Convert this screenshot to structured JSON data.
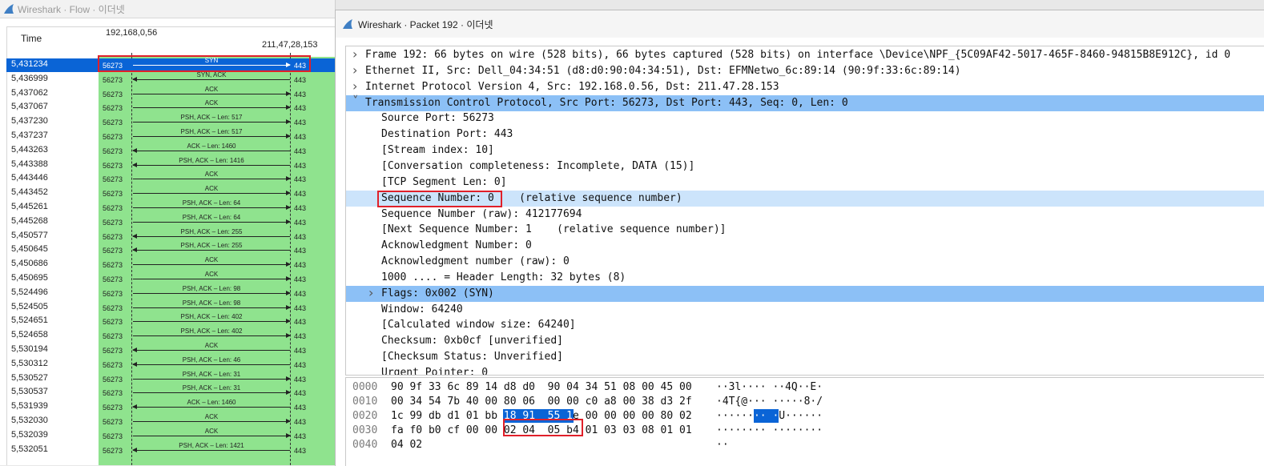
{
  "flow_window": {
    "title": "Wireshark · Flow · 이더넷",
    "header_time": "Time",
    "src_host": "192,168,0,56",
    "dst_host": "211,47,28,153",
    "rows": [
      {
        "time": "5,431234",
        "src_port": "56273",
        "label": "SYN",
        "dst_port": "443",
        "dir": "right",
        "selected": true
      },
      {
        "time": "5,436999",
        "src_port": "56273",
        "label": "SYN, ACK",
        "dst_port": "443",
        "dir": "left"
      },
      {
        "time": "5,437062",
        "src_port": "56273",
        "label": "ACK",
        "dst_port": "443",
        "dir": "right"
      },
      {
        "time": "5,437067",
        "src_port": "56273",
        "label": "ACK",
        "dst_port": "443",
        "dir": "right"
      },
      {
        "time": "5,437230",
        "src_port": "56273",
        "label": "PSH, ACK – Len: 517",
        "dst_port": "443",
        "dir": "right"
      },
      {
        "time": "5,437237",
        "src_port": "56273",
        "label": "PSH, ACK – Len: 517",
        "dst_port": "443",
        "dir": "right"
      },
      {
        "time": "5,443263",
        "src_port": "56273",
        "label": "ACK – Len: 1460",
        "dst_port": "443",
        "dir": "left"
      },
      {
        "time": "5,443388",
        "src_port": "56273",
        "label": "PSH, ACK – Len: 1416",
        "dst_port": "443",
        "dir": "left"
      },
      {
        "time": "5,443446",
        "src_port": "56273",
        "label": "ACK",
        "dst_port": "443",
        "dir": "right"
      },
      {
        "time": "5,443452",
        "src_port": "56273",
        "label": "ACK",
        "dst_port": "443",
        "dir": "right"
      },
      {
        "time": "5,445261",
        "src_port": "56273",
        "label": "PSH, ACK – Len: 64",
        "dst_port": "443",
        "dir": "right"
      },
      {
        "time": "5,445268",
        "src_port": "56273",
        "label": "PSH, ACK – Len: 64",
        "dst_port": "443",
        "dir": "right"
      },
      {
        "time": "5,450577",
        "src_port": "56273",
        "label": "PSH, ACK – Len: 255",
        "dst_port": "443",
        "dir": "left"
      },
      {
        "time": "5,450645",
        "src_port": "56273",
        "label": "PSH, ACK – Len: 255",
        "dst_port": "443",
        "dir": "left"
      },
      {
        "time": "5,450686",
        "src_port": "56273",
        "label": "ACK",
        "dst_port": "443",
        "dir": "right"
      },
      {
        "time": "5,450695",
        "src_port": "56273",
        "label": "ACK",
        "dst_port": "443",
        "dir": "right"
      },
      {
        "time": "5,524496",
        "src_port": "56273",
        "label": "PSH, ACK – Len: 98",
        "dst_port": "443",
        "dir": "right"
      },
      {
        "time": "5,524505",
        "src_port": "56273",
        "label": "PSH, ACK – Len: 98",
        "dst_port": "443",
        "dir": "right"
      },
      {
        "time": "5,524651",
        "src_port": "56273",
        "label": "PSH, ACK – Len: 402",
        "dst_port": "443",
        "dir": "right"
      },
      {
        "time": "5,524658",
        "src_port": "56273",
        "label": "PSH, ACK – Len: 402",
        "dst_port": "443",
        "dir": "right"
      },
      {
        "time": "5,530194",
        "src_port": "56273",
        "label": "ACK",
        "dst_port": "443",
        "dir": "left"
      },
      {
        "time": "5,530312",
        "src_port": "56273",
        "label": "PSH, ACK – Len: 46",
        "dst_port": "443",
        "dir": "left"
      },
      {
        "time": "5,530527",
        "src_port": "56273",
        "label": "PSH, ACK – Len: 31",
        "dst_port": "443",
        "dir": "right"
      },
      {
        "time": "5,530537",
        "src_port": "56273",
        "label": "PSH, ACK – Len: 31",
        "dst_port": "443",
        "dir": "right"
      },
      {
        "time": "5,531939",
        "src_port": "56273",
        "label": "ACK – Len: 1460",
        "dst_port": "443",
        "dir": "left"
      },
      {
        "time": "5,532030",
        "src_port": "56273",
        "label": "ACK",
        "dst_port": "443",
        "dir": "right"
      },
      {
        "time": "5,532039",
        "src_port": "56273",
        "label": "ACK",
        "dst_port": "443",
        "dir": "right"
      },
      {
        "time": "5,532051",
        "src_port": "56273",
        "label": "PSH, ACK – Len: 1421",
        "dst_port": "443",
        "dir": "left"
      }
    ]
  },
  "packet_window": {
    "title": "Wireshark · Packet 192 · 이더넷",
    "tree": [
      {
        "indent": 0,
        "expander": "right",
        "text": "Frame 192: 66 bytes on wire (528 bits), 66 bytes captured (528 bits) on interface \\Device\\NPF_{5C09AF42-5017-465F-8460-94815B8E912C}, id 0"
      },
      {
        "indent": 0,
        "expander": "right",
        "text": "Ethernet II, Src: Dell_04:34:51 (d8:d0:90:04:34:51), Dst: EFMNetwo_6c:89:14 (90:9f:33:6c:89:14)"
      },
      {
        "indent": 0,
        "expander": "right",
        "text": "Internet Protocol Version 4, Src: 192.168.0.56, Dst: 211.47.28.153"
      },
      {
        "indent": 0,
        "expander": "down",
        "text": "Transmission Control Protocol, Src Port: 56273, Dst Port: 443, Seq: 0, Len: 0",
        "highlight": "dark"
      },
      {
        "indent": 1,
        "text": "Source Port: 56273"
      },
      {
        "indent": 1,
        "text": "Destination Port: 443"
      },
      {
        "indent": 1,
        "text": "[Stream index: 10]"
      },
      {
        "indent": 1,
        "text": "[Conversation completeness: Incomplete, DATA (15)]"
      },
      {
        "indent": 1,
        "text": "[TCP Segment Len: 0]"
      },
      {
        "indent": 1,
        "text": "Sequence Number: 0    (relative sequence number)",
        "highlight": "light"
      },
      {
        "indent": 1,
        "text": "Sequence Number (raw): 412177694"
      },
      {
        "indent": 1,
        "text": "[Next Sequence Number: 1    (relative sequence number)]"
      },
      {
        "indent": 1,
        "text": "Acknowledgment Number: 0"
      },
      {
        "indent": 1,
        "text": "Acknowledgment number (raw): 0"
      },
      {
        "indent": 1,
        "text": "1000 .... = Header Length: 32 bytes (8)"
      },
      {
        "indent": 1,
        "expander": "right",
        "text": "Flags: 0x002 (SYN)",
        "highlight": "dark"
      },
      {
        "indent": 1,
        "text": "Window: 64240"
      },
      {
        "indent": 1,
        "text": "[Calculated window size: 64240]"
      },
      {
        "indent": 1,
        "text": "Checksum: 0xb0cf [unverified]"
      },
      {
        "indent": 1,
        "text": "[Checksum Status: Unverified]"
      },
      {
        "indent": 1,
        "text": "Urgent Pointer: 0"
      }
    ],
    "hex": [
      {
        "offset": "0000",
        "bytes": "90 9f 33 6c 89 14 d8 d0  90 04 34 51 08 00 45 00",
        "ascii": "··3l···· ··4Q··E·"
      },
      {
        "offset": "0010",
        "bytes": "00 34 54 7b 40 00 80 06  00 00 c0 a8 00 38 d3 2f",
        "ascii": "·4T{@··· ·····8·/"
      },
      {
        "offset": "0020",
        "bytes": "1c 99 db d1 01 bb 18 91  55 1e 00 00 00 00 80 02",
        "ascii": "········ ·U······",
        "highlight": {
          "start": 18,
          "end": 29,
          "ascii_start": 6,
          "ascii_end": 10
        }
      },
      {
        "offset": "0030",
        "bytes": "fa f0 b0 cf 00 00 02 04  05 b4 01 03 03 08 01 01",
        "ascii": "········ ········"
      },
      {
        "offset": "0040",
        "bytes": "04 02",
        "ascii": "··"
      }
    ]
  },
  "colors": {
    "selection": "#0a64d6",
    "flow_green": "#8fe38e",
    "highlight_dark": "#8cc0f6",
    "highlight_light": "#cce4fb",
    "annotation_red": "#e0202a"
  }
}
